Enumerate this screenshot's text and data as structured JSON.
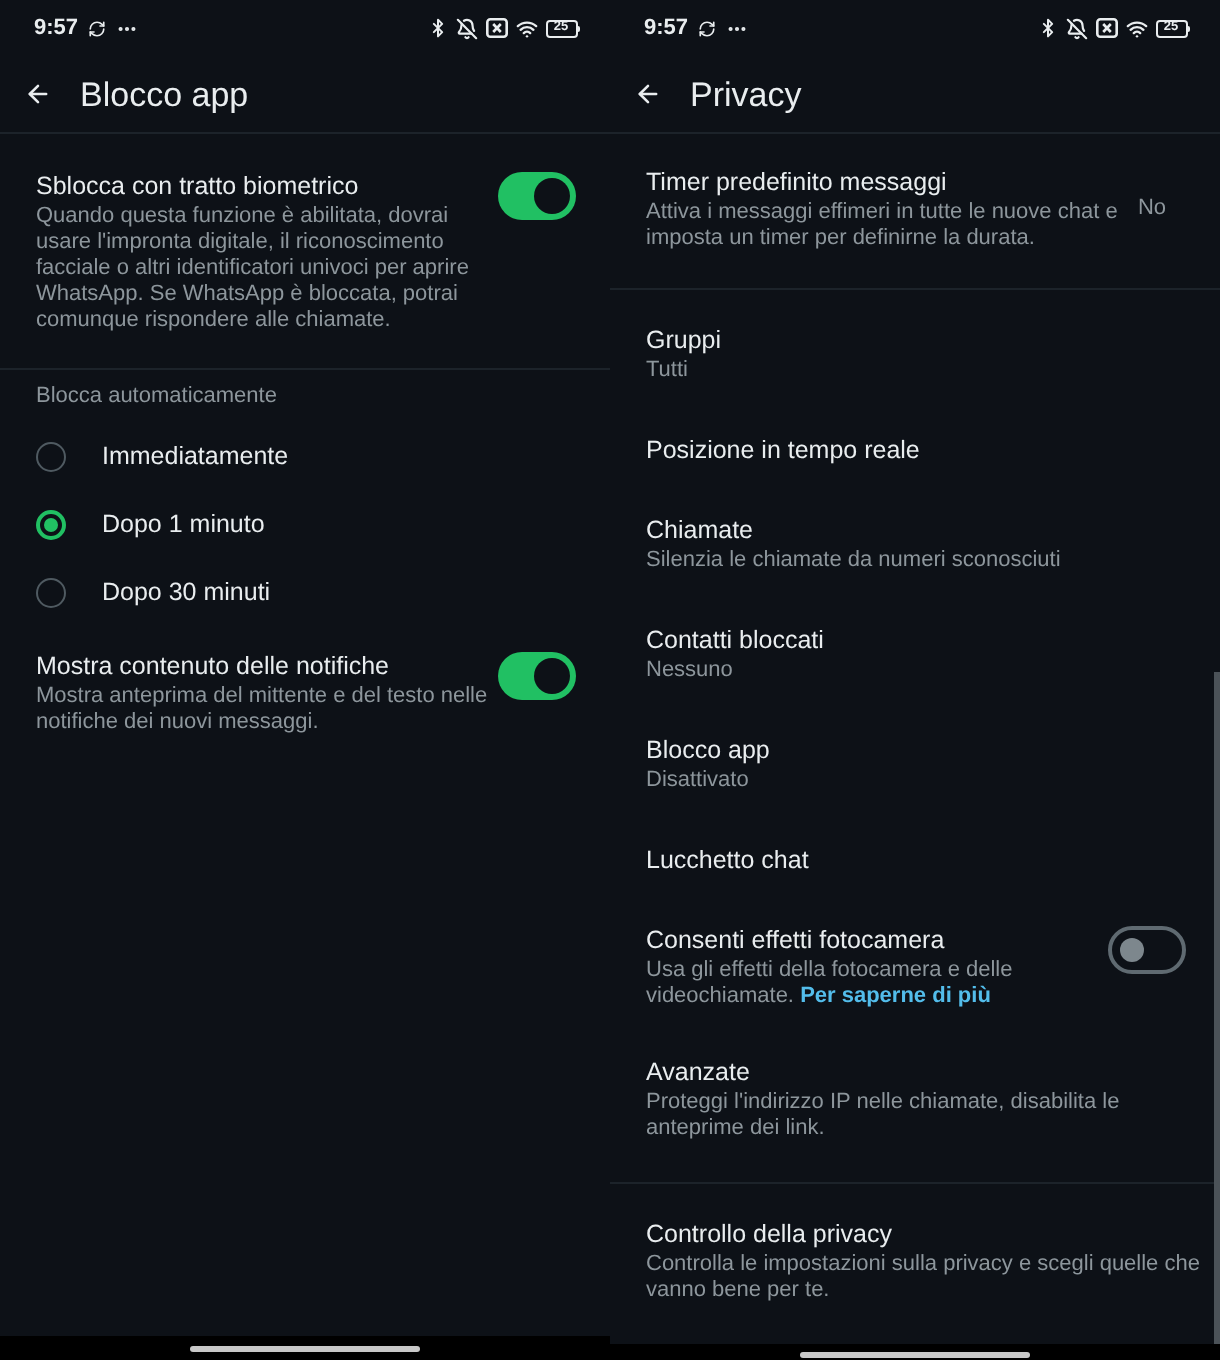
{
  "screens": [
    {
      "status_bar": {
        "time": "9:57",
        "battery": "25"
      },
      "header": {
        "title": "Blocco app"
      },
      "sections": [
        {
          "items": [
            {
              "kind": "toggle",
              "title": "Sblocca con tratto biometrico",
              "description": "Quando questa funzione è abilitata, dovrai usare l'impronta digitale, il riconoscimento facciale o altri identificatori univoci per aprire WhatsApp. Se WhatsApp è bloccata, potrai comunque rispondere alle chiamate.",
              "on": true
            }
          ]
        },
        {
          "title": "Blocca automaticamente",
          "items": [
            {
              "kind": "radio",
              "label": "Immediatamente",
              "selected": false
            },
            {
              "kind": "radio",
              "label": "Dopo 1 minuto",
              "selected": true
            },
            {
              "kind": "radio",
              "label": "Dopo 30 minuti",
              "selected": false
            },
            {
              "kind": "toggle",
              "title": "Mostra contenuto delle notifiche",
              "description": "Mostra anteprima del mittente e del testo nelle notifiche dei nuovi messaggi.",
              "on": true
            }
          ]
        }
      ]
    },
    {
      "status_bar": {
        "time": "9:57",
        "battery": "25"
      },
      "header": {
        "title": "Privacy"
      },
      "scroll_indicator": true,
      "sections": [
        {
          "items": [
            {
              "kind": "value",
              "title": "Timer predefinito messaggi",
              "description": "Attiva i messaggi effimeri in tutte le nuove chat e imposta un timer per definirne la durata.",
              "value": "No"
            }
          ]
        },
        {
          "items": [
            {
              "kind": "nav",
              "title": "Gruppi",
              "subtitle": "Tutti"
            },
            {
              "kind": "nav",
              "title": "Posizione in tempo reale"
            },
            {
              "kind": "nav",
              "title": "Chiamate",
              "subtitle": "Silenzia le chiamate da numeri sconosciuti"
            },
            {
              "kind": "nav",
              "title": "Contatti bloccati",
              "subtitle": "Nessuno"
            },
            {
              "kind": "nav",
              "title": "Blocco app",
              "subtitle": "Disattivato"
            },
            {
              "kind": "nav",
              "title": "Lucchetto chat"
            },
            {
              "kind": "toggle",
              "title": "Consenti effetti fotocamera",
              "description": "Usa gli effetti della fotocamera e delle videochiamate.",
              "link": "Per saperne di più",
              "on": false
            },
            {
              "kind": "nav",
              "title": "Avanzate",
              "subtitle": "Proteggi l'indirizzo IP nelle chiamate, disabilita le anteprime dei link."
            }
          ]
        },
        {
          "items": [
            {
              "kind": "nav",
              "title": "Controllo della privacy",
              "subtitle": "Controlla le impostazioni sulla privacy e scegli quelle che vanno bene per te."
            }
          ]
        }
      ]
    }
  ]
}
